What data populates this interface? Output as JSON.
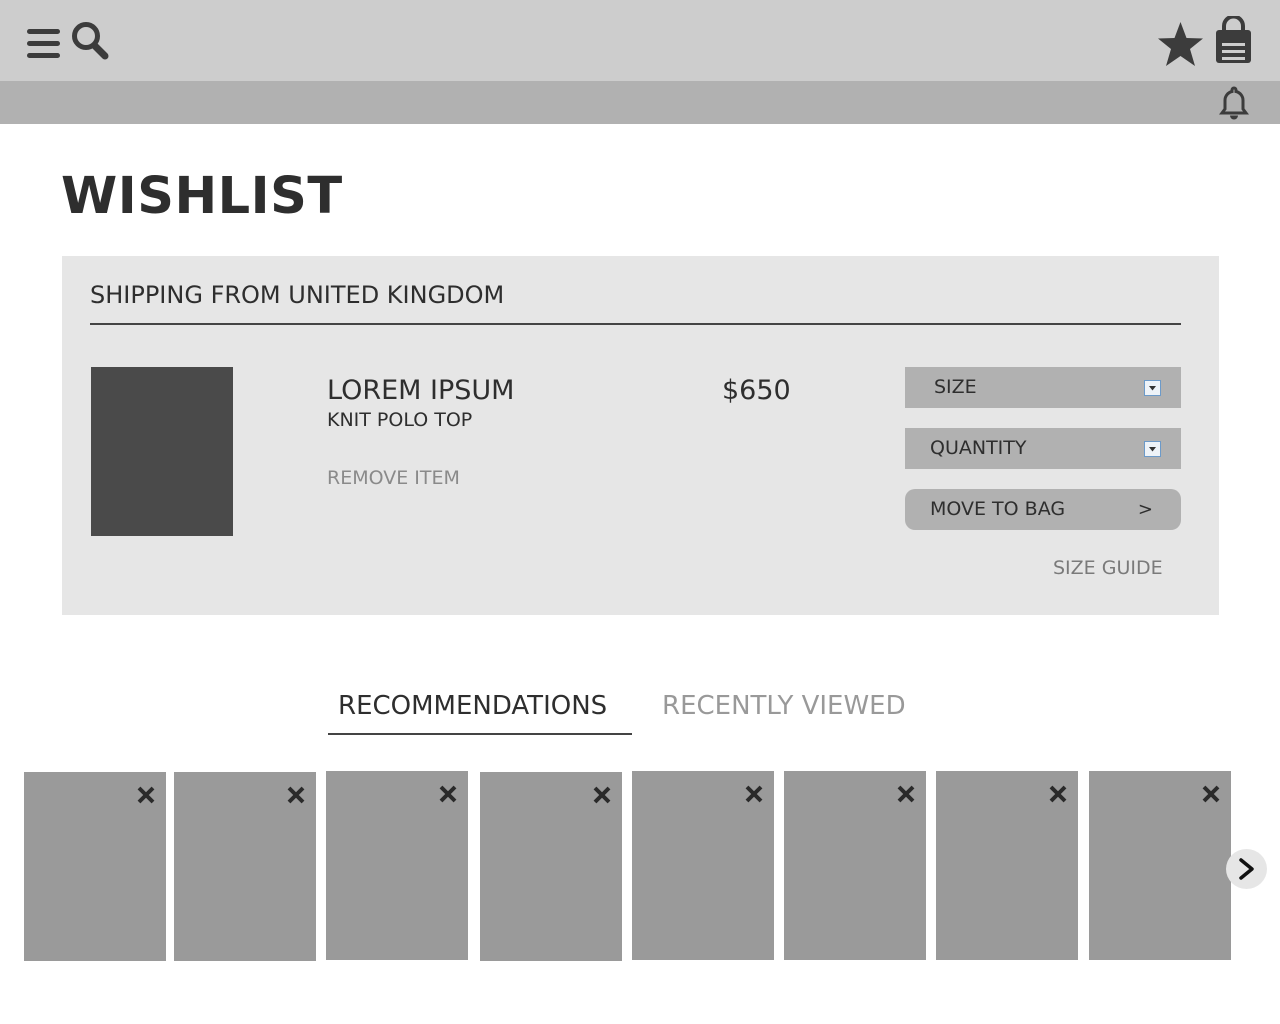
{
  "header": {
    "icons": [
      "menu-icon",
      "search-icon",
      "star-icon",
      "bag-icon",
      "bell-icon"
    ]
  },
  "page": {
    "title": "WISHLIST"
  },
  "wishlist": {
    "shipping_label": "SHIPPING FROM UNITED KINGDOM",
    "item": {
      "name": "LOREM IPSUM",
      "description": "KNIT POLO TOP",
      "remove_label": "REMOVE ITEM",
      "price": "$650",
      "size_label": "SIZE",
      "quantity_label": "QUANTITY",
      "move_label": "MOVE TO BAG",
      "move_chevron": ">",
      "size_guide_label": "SIZE GUIDE"
    }
  },
  "tabs": [
    {
      "label": "RECOMMENDATIONS",
      "active": true
    },
    {
      "label": "RECENTLY VIEWED",
      "active": false
    }
  ],
  "carousel": {
    "card_count": 8,
    "next_icon": "chevron-right-icon"
  },
  "colors": {
    "topbar": "#cdcdcd",
    "subbar": "#b1b1b1",
    "panel": "#e6e6e6",
    "image_placeholder": "#4a4a4a",
    "card": "#9a9a9a",
    "text": "#2e2e2e",
    "muted": "#8a8a8a"
  }
}
